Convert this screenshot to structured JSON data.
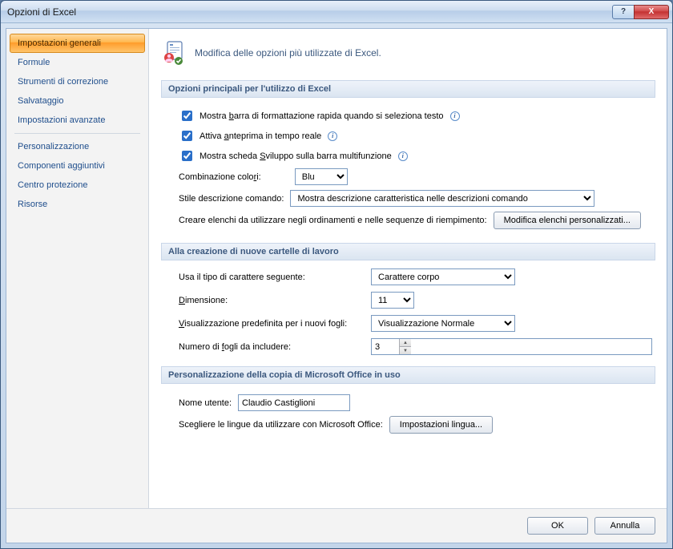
{
  "window": {
    "title": "Opzioni di Excel",
    "help_label": "?",
    "close_label": "X"
  },
  "sidebar": {
    "items": [
      {
        "label": "Impostazioni generali",
        "active": true
      },
      {
        "label": "Formule"
      },
      {
        "label": "Strumenti di correzione"
      },
      {
        "label": "Salvataggio"
      },
      {
        "label": "Impostazioni avanzate"
      },
      {
        "sep": true
      },
      {
        "label": "Personalizzazione"
      },
      {
        "label": "Componenti aggiuntivi"
      },
      {
        "label": "Centro protezione"
      },
      {
        "label": "Risorse"
      }
    ]
  },
  "header": {
    "subtitle": "Modifica delle opzioni più utilizzate di Excel."
  },
  "section_main": {
    "title": "Opzioni principali per l'utilizzo di Excel",
    "chk1_pre": "Mostra ",
    "chk1_accel": "b",
    "chk1_post": "arra di formattazione rapida quando si seleziona testo",
    "chk2_pre": "Attiva ",
    "chk2_accel": "a",
    "chk2_post": "nteprima in tempo reale",
    "chk3_pre": "Mostra scheda ",
    "chk3_accel": "S",
    "chk3_post": "viluppo sulla barra multifunzione",
    "color_label_pre": "Combinazione colo",
    "color_label_accel": "r",
    "color_label_post": "i:",
    "color_value": "Blu",
    "tooltip_style_label": "Stile descrizione comando:",
    "tooltip_style_value": "Mostra descrizione caratteristica nelle descrizioni comando",
    "custom_lists_label": "Creare elenchi da utilizzare negli ordinamenti e nelle sequenze di riempimento:",
    "custom_lists_button": "Modifica elenchi personalizzati..."
  },
  "section_newwb": {
    "title": "Alla creazione di nuove cartelle di lavoro",
    "font_label": "Usa il tipo di carattere seguente:",
    "font_value": "Carattere corpo",
    "size_label_accel": "D",
    "size_label_post": "imensione:",
    "size_value": "11",
    "view_label_accel": "V",
    "view_label_post": "isualizzazione predefinita per i nuovi fogli:",
    "view_value": "Visualizzazione Normale",
    "sheets_label_pre": "Numero di ",
    "sheets_label_accel": "f",
    "sheets_label_post": "ogli da includere:",
    "sheets_value": "3"
  },
  "section_personalize": {
    "title": "Personalizzazione della copia di Microsoft Office in uso",
    "username_label": "Nome utente:",
    "username_value": "Claudio Castiglioni",
    "lang_label": "Scegliere le lingue da utilizzare con Microsoft Office:",
    "lang_button": "Impostazioni lingua..."
  },
  "footer": {
    "ok": "OK",
    "cancel": "Annulla"
  }
}
